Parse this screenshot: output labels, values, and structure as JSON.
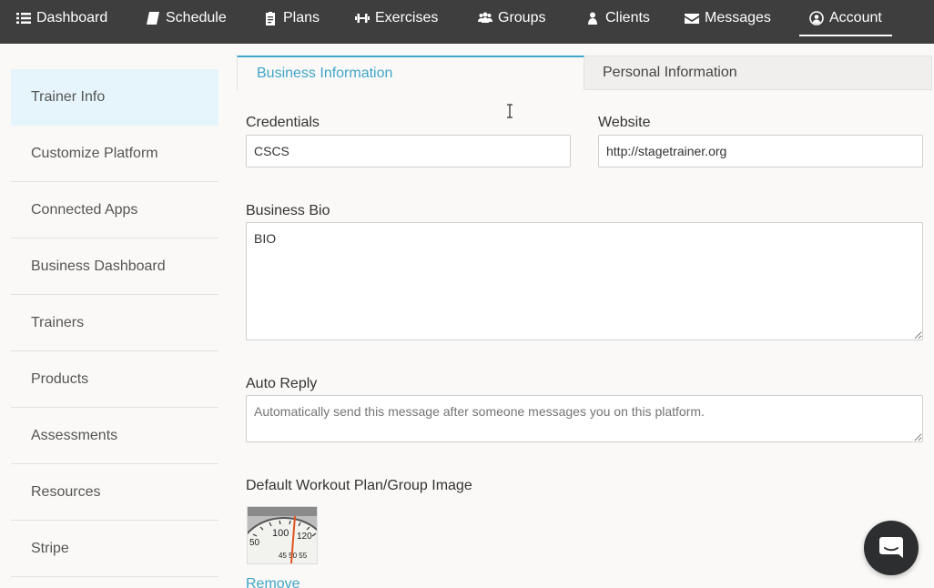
{
  "nav": {
    "items": [
      {
        "label": "Dashboard",
        "icon": "list-icon"
      },
      {
        "label": "Schedule",
        "icon": "book-icon"
      },
      {
        "label": "Plans",
        "icon": "clipboard-icon"
      },
      {
        "label": "Exercises",
        "icon": "dumbbell-icon"
      },
      {
        "label": "Groups",
        "icon": "users-icon"
      },
      {
        "label": "Clients",
        "icon": "user-icon"
      },
      {
        "label": "Messages",
        "icon": "envelope-icon"
      },
      {
        "label": "Account",
        "icon": "user-circle-icon"
      }
    ],
    "active": "Account"
  },
  "sidebar": {
    "items": [
      {
        "label": "Trainer Info"
      },
      {
        "label": "Customize Platform"
      },
      {
        "label": "Connected Apps"
      },
      {
        "label": "Business Dashboard"
      },
      {
        "label": "Trainers"
      },
      {
        "label": "Products"
      },
      {
        "label": "Assessments"
      },
      {
        "label": "Resources"
      },
      {
        "label": "Stripe"
      }
    ],
    "active": "Trainer Info"
  },
  "tabs": {
    "active": "Business Information",
    "inactive": "Personal Information"
  },
  "form": {
    "credentials_label": "Credentials",
    "credentials_value": "CSCS",
    "website_label": "Website",
    "website_value": "http://stagetrainer.org",
    "bio_label": "Business Bio",
    "bio_value": "BIO",
    "auto_reply_label": "Auto Reply",
    "auto_reply_placeholder": "Automatically send this message after someone messages you on this platform.",
    "image_label": "Default Workout Plan/Group Image",
    "remove_label": "Remove"
  },
  "colors": {
    "nav_bg": "#3d3e3d",
    "accent": "#3fa6c8",
    "active_sidebar_bg": "#e5f5fb"
  }
}
